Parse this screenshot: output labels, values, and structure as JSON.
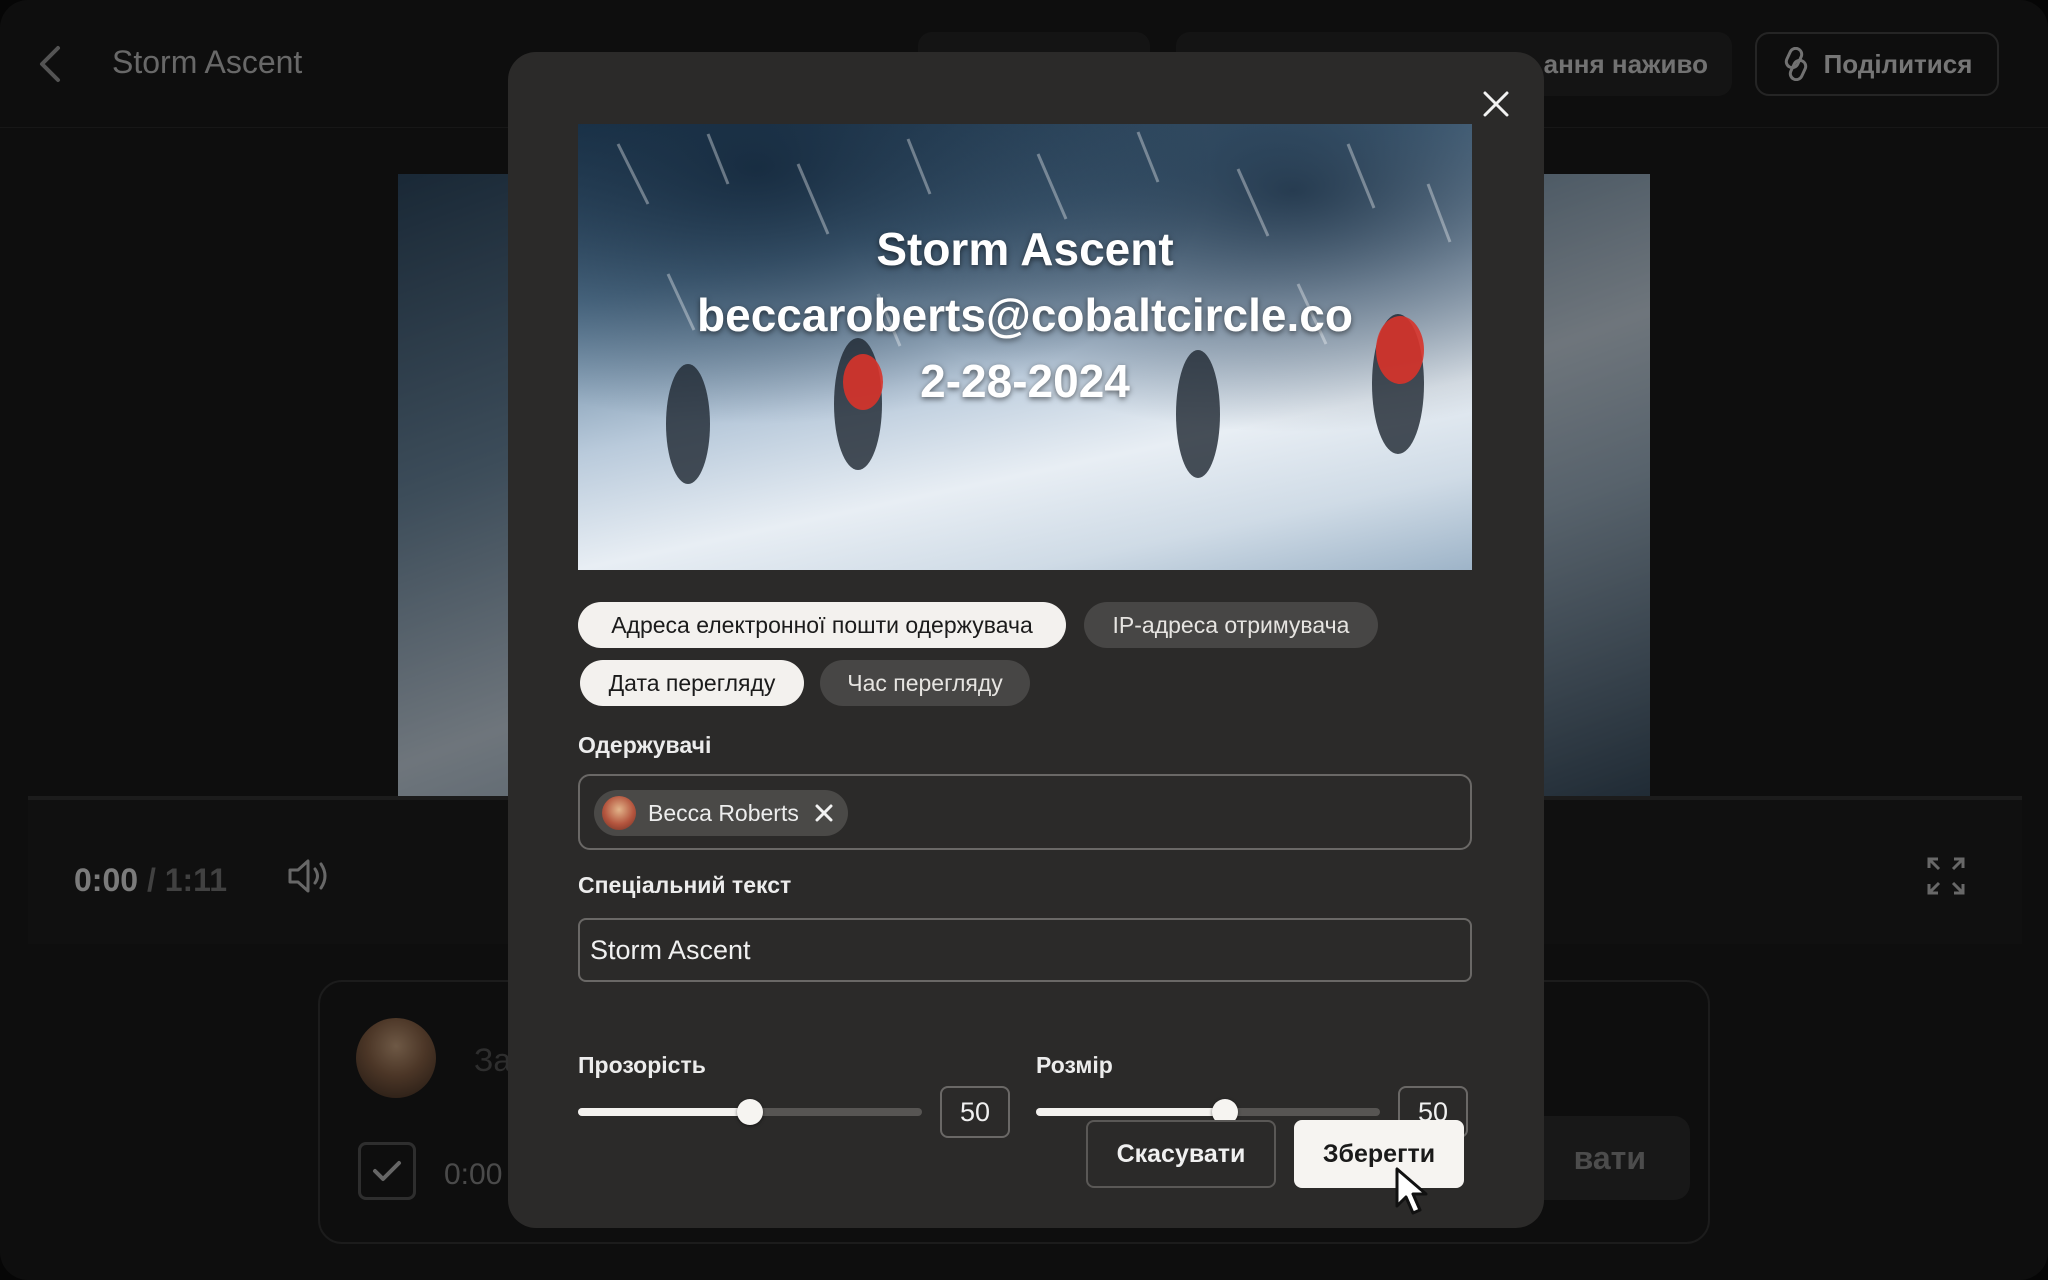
{
  "app": {
    "title": "Storm Ascent",
    "live_button_label": "ання наживо",
    "share_button_label": "Поділитися"
  },
  "player": {
    "current_time": "0:00",
    "separator": " / ",
    "duration": "1:11"
  },
  "comment": {
    "placeholder_partial": "За",
    "timestamp": "0:00",
    "send_label_partial": "вати"
  },
  "modal": {
    "watermark_preview": {
      "line1": "Storm Ascent",
      "line2": "beccaroberts@cobaltcircle.co",
      "line3": "2-28-2024"
    },
    "options": [
      {
        "label": "Адреса електронної пошти одержувача",
        "selected": true
      },
      {
        "label": "IP-адреса отримувача",
        "selected": false
      },
      {
        "label": "Дата перегляду",
        "selected": true
      },
      {
        "label": "Час перегляду",
        "selected": false
      }
    ],
    "recipients_label": "Одержувачі",
    "recipients": [
      {
        "name": "Becca Roberts"
      }
    ],
    "custom_text_label": "Спеціальний текст",
    "custom_text_value": "Storm Ascent",
    "opacity": {
      "label": "Прозорість",
      "value": "50",
      "fraction": 0.5
    },
    "size": {
      "label": "Розмір",
      "value": "50",
      "fraction": 0.5
    },
    "cancel_label": "Скасувати",
    "save_label": "Зберегти"
  },
  "colors": {
    "modal_bg": "#2b2a29",
    "chip_selected": "#f3f1ee",
    "chip_unselected": "#474645",
    "accent_light": "#f6f4f1"
  }
}
